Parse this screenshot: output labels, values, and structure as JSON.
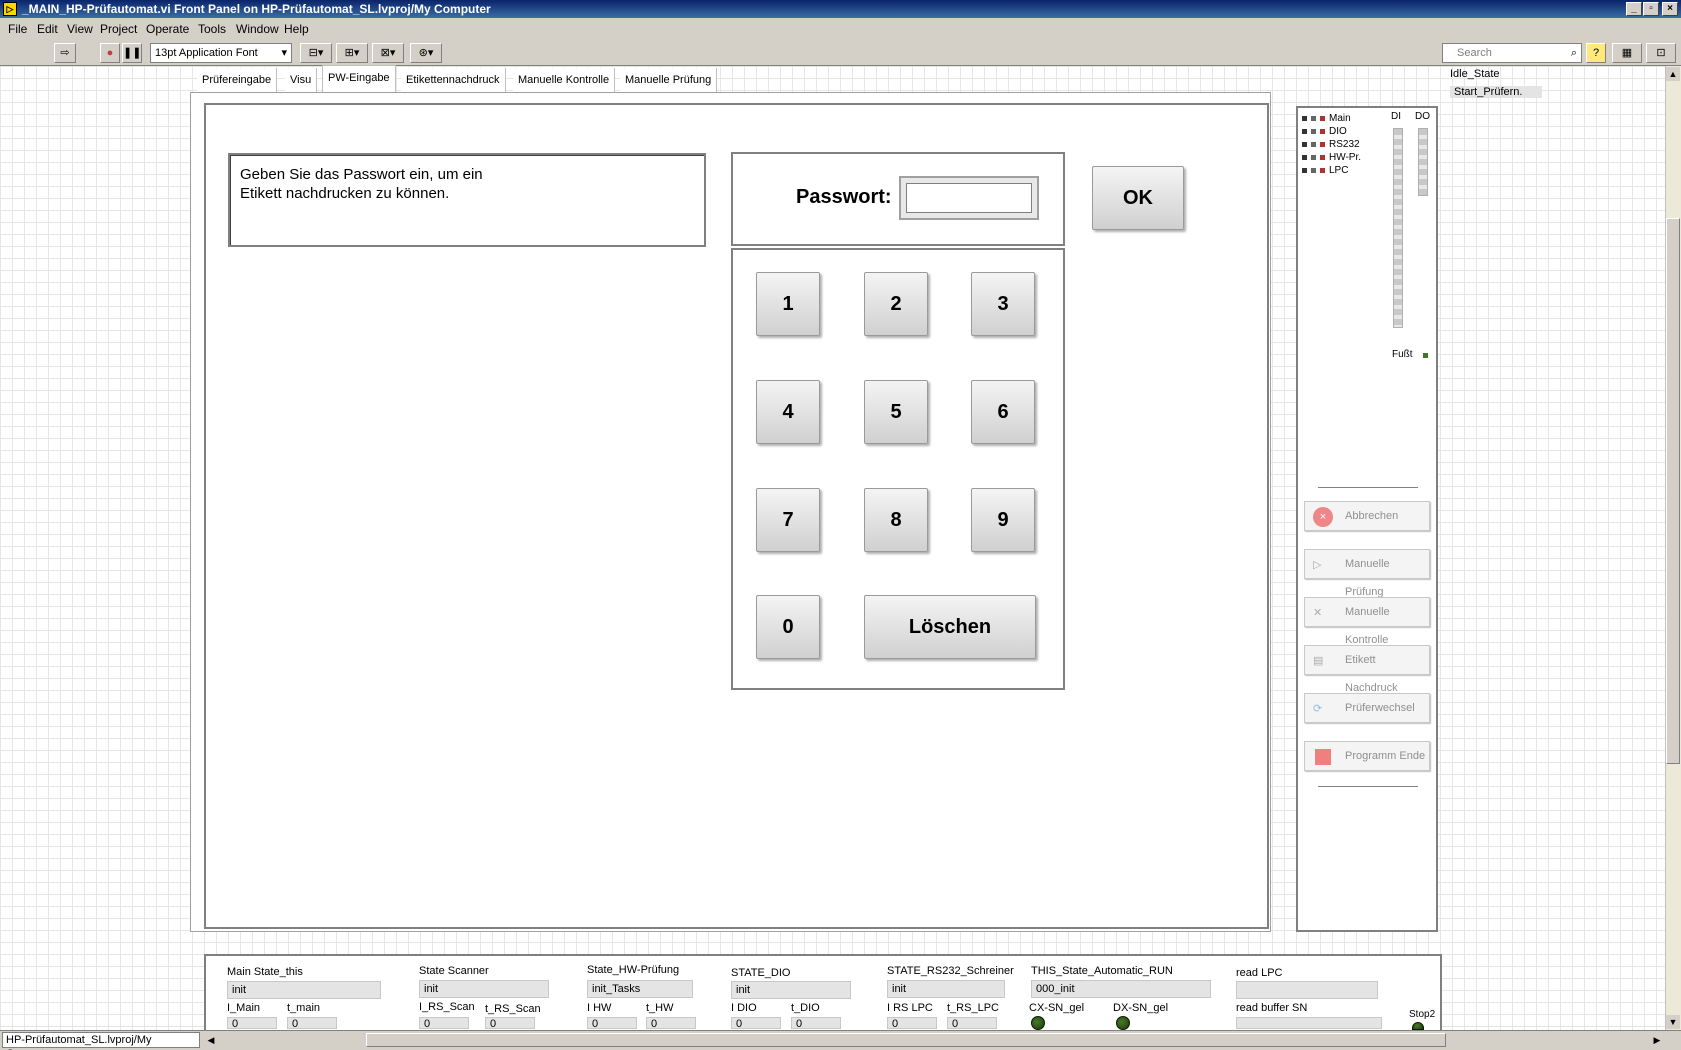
{
  "window": {
    "title": "_MAIN_HP-Prüfautomat.vi Front Panel on HP-Prüfautomat_SL.lvproj/My Computer",
    "min": "_",
    "max": "▫",
    "close": "×"
  },
  "menu": [
    "File",
    "Edit",
    "View",
    "Project",
    "Operate",
    "Tools",
    "Window",
    "Help"
  ],
  "toolbar": {
    "font": "13pt Application Font",
    "search_placeholder": "Search",
    "help": "?"
  },
  "tabs": [
    "Prüfereingabe",
    "Visu",
    "PW-Eingabe",
    "Etikettennachdruck",
    "Manuelle Kontrolle",
    "Manuelle Prüfung"
  ],
  "main": {
    "message_line1": "Geben Sie das Passwort ein, um ein",
    "message_line2": "Etikett nachdrucken zu können.",
    "password_label": "Passwort:",
    "password_value": "",
    "ok": "OK",
    "keys": [
      "1",
      "2",
      "3",
      "4",
      "5",
      "6",
      "7",
      "8",
      "9",
      "0"
    ],
    "clear": "Löschen"
  },
  "states": [
    "Idle_State",
    "Start_Prüfern."
  ],
  "right": {
    "leds": [
      "Main",
      "DIO",
      "RS232",
      "HW-Pr.",
      "LPC"
    ],
    "di": "DI",
    "do": "DO",
    "fuss": "Fußt",
    "buttons": [
      "Abbrechen",
      "Manuelle Prüfung",
      "Manuelle Kontrolle",
      "Etikett Nachdruck",
      "Prüferwechsel",
      "Programm Ende"
    ]
  },
  "bottom": {
    "main_state": {
      "label": "Main State_this",
      "value": "init",
      "i_label": "I_Main",
      "i_value": "0",
      "t_label": "t_main",
      "t_value": "0"
    },
    "scanner": {
      "label": "State Scanner",
      "value": "init",
      "i_label": "I_RS_Scan",
      "i_value": "0",
      "t_label": "t_RS_Scan",
      "t_value": "0"
    },
    "hw": {
      "label": "State_HW-Prüfung",
      "value": "init_Tasks",
      "i_label": "I HW",
      "i_value": "0",
      "t_label": "t_HW",
      "t_value": "0"
    },
    "dio": {
      "label": "STATE_DIO",
      "value": "init",
      "i_label": "I DIO",
      "i_value": "0",
      "t_label": "t_DIO",
      "t_value": "0"
    },
    "rs232": {
      "label": "STATE_RS232_Schreiner",
      "value": "init",
      "i_label": "I RS LPC",
      "i_value": "0",
      "t_label": "t_RS_LPC",
      "t_value": "0"
    },
    "auto": {
      "label": "THIS_State_Automatic_RUN",
      "value": "000_init",
      "cx": "CX-SN_gel",
      "dx": "DX-SN_gel"
    },
    "lpc": {
      "label": "read LPC",
      "value": "",
      "buffer_label": "read buffer SN",
      "buffer_value": ""
    },
    "stop": "Stop2"
  },
  "status": {
    "path": "HP-Prüfautomat_SL.lvproj/My Computer"
  }
}
